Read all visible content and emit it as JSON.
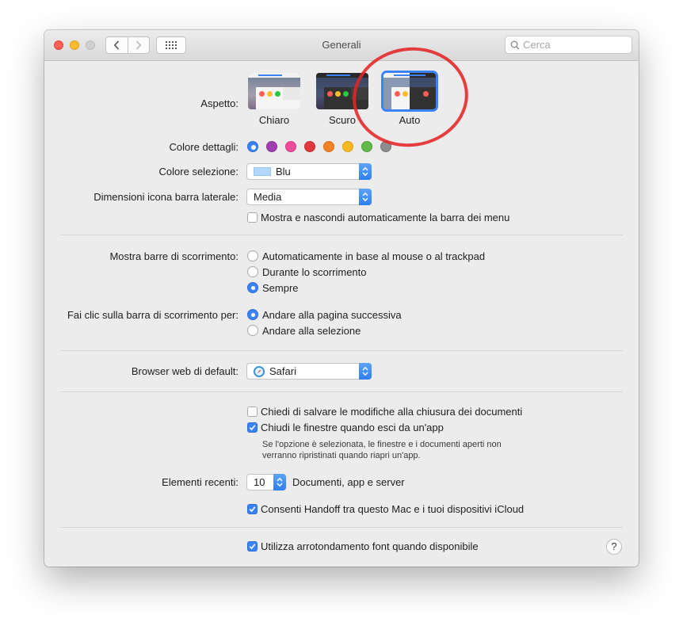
{
  "window": {
    "title": "Generali"
  },
  "search": {
    "placeholder": "Cerca"
  },
  "appearance": {
    "label": "Aspetto:",
    "options": [
      {
        "name": "Chiaro",
        "selected": false
      },
      {
        "name": "Scuro",
        "selected": false
      },
      {
        "name": "Auto",
        "selected": true
      }
    ]
  },
  "accent": {
    "label": "Colore dettagli:",
    "colors": [
      "#3b82f7",
      "#a040b0",
      "#ec4c9a",
      "#e0383e",
      "#f18226",
      "#f6b820",
      "#62b848",
      "#8c8c8c"
    ],
    "selected_index": 0
  },
  "highlight": {
    "label": "Colore selezione:",
    "value": "Blu",
    "swatch_color": "#b3d6fb"
  },
  "sidebar_icon_size": {
    "label": "Dimensioni icona barra laterale:",
    "value": "Media"
  },
  "menubar_autohide": {
    "label": "Mostra e nascondi automaticamente la barra dei menu",
    "checked": false
  },
  "scrollbars": {
    "label": "Mostra barre di scorrimento:",
    "options": [
      "Automaticamente in base al mouse o al trackpad",
      "Durante lo scorrimento",
      "Sempre"
    ],
    "selected_index": 2
  },
  "scroll_click": {
    "label": "Fai clic sulla barra di scorrimento per:",
    "options": [
      "Andare alla pagina successiva",
      "Andare alla selezione"
    ],
    "selected_index": 0
  },
  "browser": {
    "label": "Browser web di default:",
    "value": "Safari"
  },
  "documents": {
    "ask_save": {
      "label": "Chiedi di salvare le modifiche alla chiusura dei documenti",
      "checked": false
    },
    "close_windows": {
      "label": "Chiudi le finestre quando esci da un'app",
      "checked": true
    },
    "close_windows_note_line1": "Se l'opzione è selezionata, le finestre e i documenti aperti non",
    "close_windows_note_line2": "verranno ripristinati quando riapri un'app."
  },
  "recent_items": {
    "label": "Elementi recenti:",
    "value": "10",
    "suffix": "Documenti, app e server"
  },
  "handoff": {
    "label": "Consenti Handoff tra questo Mac e i tuoi dispositivi iCloud",
    "checked": true
  },
  "font_smoothing": {
    "label": "Utilizza arrotondamento font quando disponibile",
    "checked": true
  },
  "help": {
    "label": "?"
  }
}
